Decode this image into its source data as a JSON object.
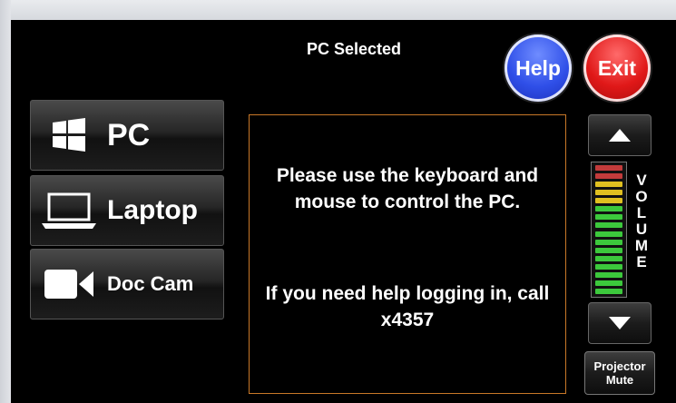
{
  "header": {
    "title": "PC Selected"
  },
  "buttons": {
    "help": "Help",
    "exit": "Exit"
  },
  "sources": [
    {
      "label": "PC",
      "icon": "windows-logo-icon"
    },
    {
      "label": "Laptop",
      "icon": "laptop-icon"
    },
    {
      "label": "Doc Cam",
      "icon": "video-camera-icon"
    }
  ],
  "message": {
    "line1": "Please use the keyboard and mouse to control the PC.",
    "line2": "If you need help logging in, call x4357"
  },
  "volume": {
    "letters": [
      "V",
      "O",
      "L",
      "U",
      "M",
      "E"
    ],
    "segments_total": 16,
    "segment_colors": [
      "#c23b3b",
      "#c23b3b",
      "#e0c020",
      "#e0c020",
      "#e0c020",
      "#3cc83c",
      "#3cc83c",
      "#3cc83c",
      "#3cc83c",
      "#3cc83c",
      "#3cc83c",
      "#3cc83c",
      "#3cc83c",
      "#3cc83c",
      "#3cc83c",
      "#3cc83c"
    ],
    "up_icon": "triangle-up-icon",
    "down_icon": "triangle-down-icon"
  },
  "projector": {
    "line1": "Projector",
    "line2": "Mute"
  },
  "colors": {
    "help": "#2f4fe8",
    "exit": "#e01818",
    "message_border": "#c87828",
    "background": "#000000"
  }
}
